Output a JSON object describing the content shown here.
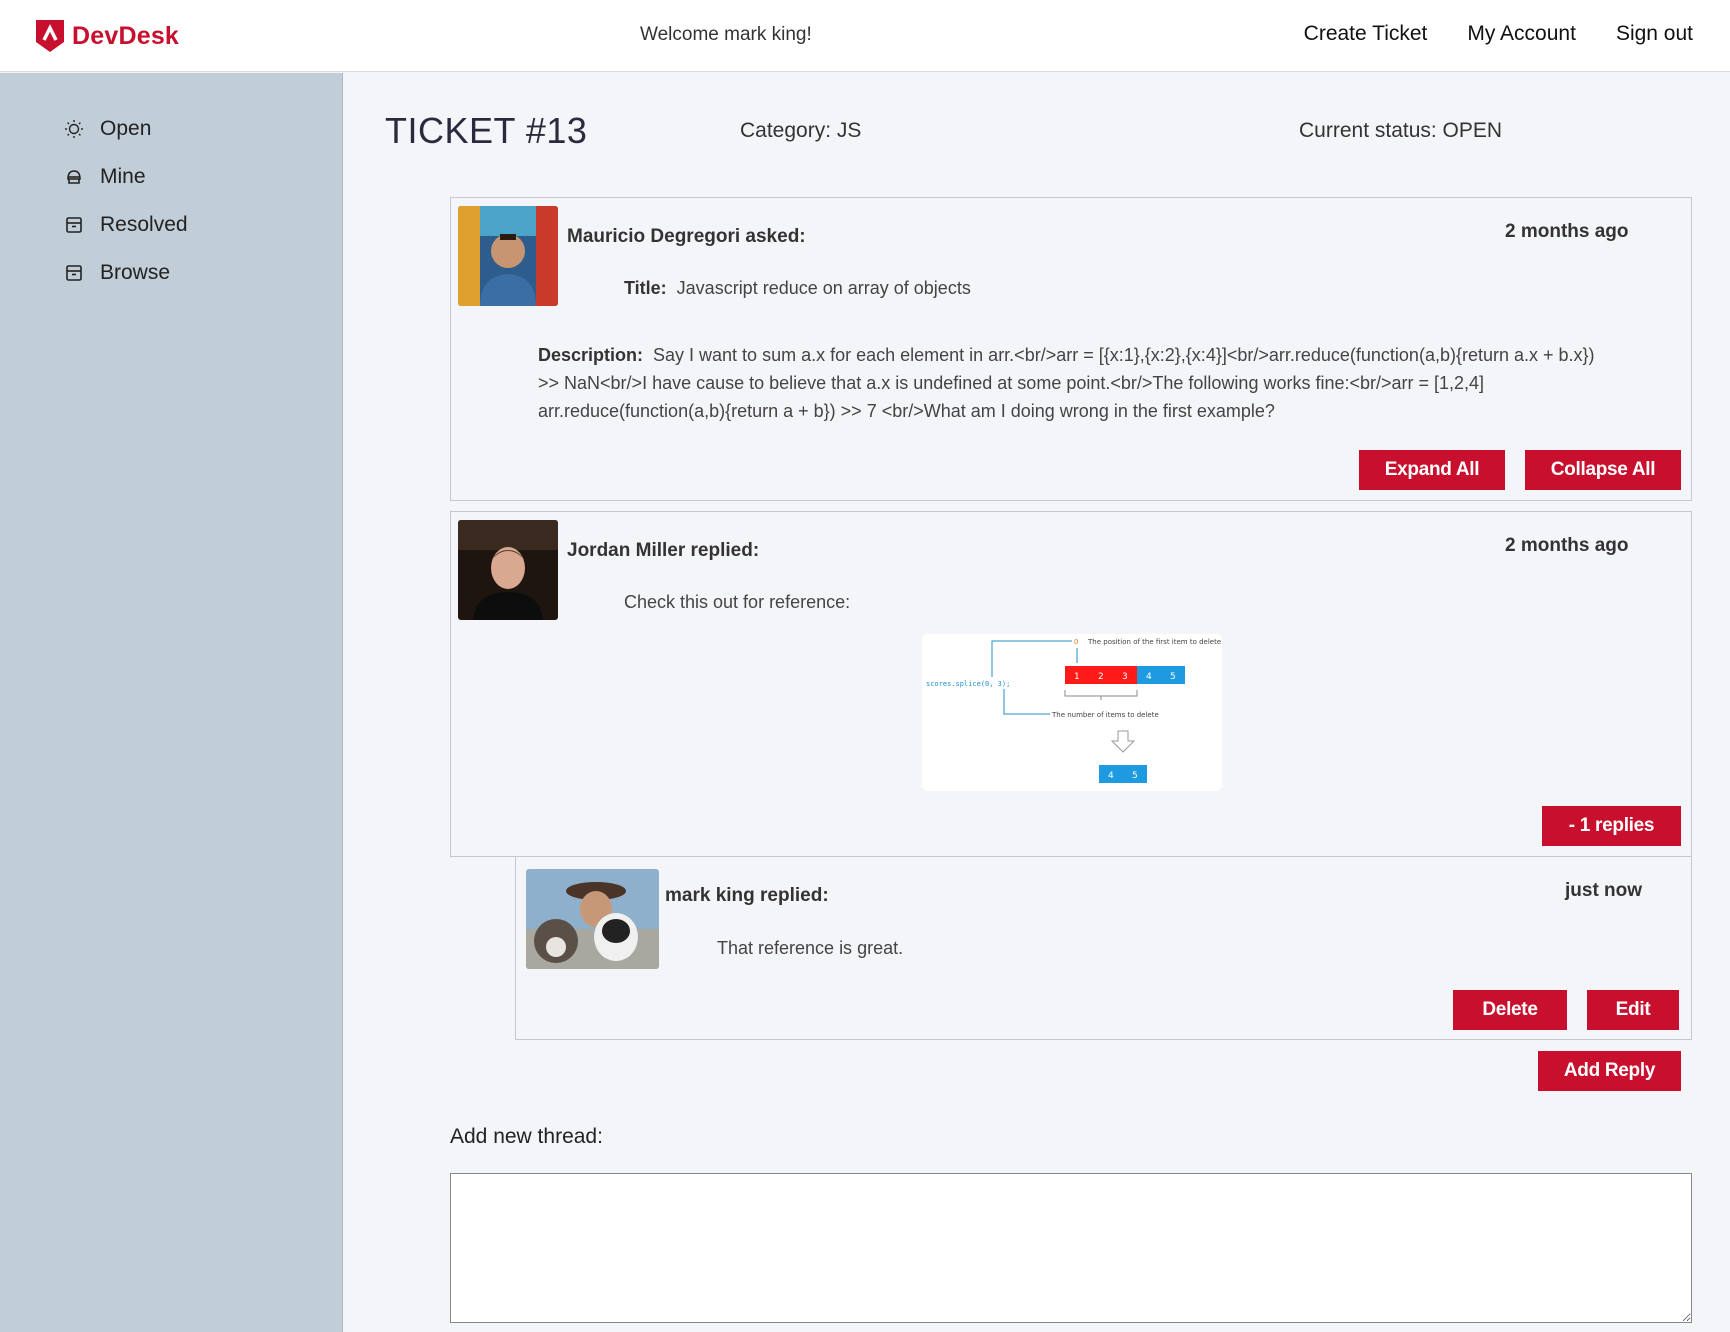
{
  "app": {
    "name": "DevDesk",
    "welcome": "Welcome mark king!"
  },
  "nav": {
    "create": "Create Ticket",
    "account": "My Account",
    "signout": "Sign out"
  },
  "sidebar": {
    "items": [
      {
        "label": "Open",
        "icon": "lightbulb-icon"
      },
      {
        "label": "Mine",
        "icon": "helmet-icon"
      },
      {
        "label": "Resolved",
        "icon": "archive-icon"
      },
      {
        "label": "Browse",
        "icon": "archive-icon"
      }
    ]
  },
  "ticket": {
    "title": "TICKET #13",
    "category": "Category: JS",
    "status": "Current status: OPEN"
  },
  "question": {
    "author": "Mauricio Degregori asked:",
    "time": "2 months ago",
    "title_label": "Title:",
    "title": "Javascript reduce on array of objects",
    "desc_label": "Description:",
    "description": "Say I want to sum a.x for each element in arr.<br/>arr = [{x:1},{x:2},{x:4}]<br/>arr.reduce(function(a,b){return a.x + b.x}) >> NaN<br/>I have cause to believe that a.x is undefined at some point.<br/>The following works fine:<br/>arr = [1,2,4] arr.reduce(function(a,b){return a + b}) >> 7 <br/>What am I doing wrong in the first example?",
    "expand": "Expand All",
    "collapse": "Collapse All"
  },
  "reply1": {
    "author": "Jordan Miller replied:",
    "time": "2 months ago",
    "text": "Check this out for reference:",
    "replies_btn": "- 1 replies",
    "diagram": {
      "code": "scores.splice(0, 3);",
      "top_label": "The position of the first item to delete",
      "bottom_label": "The number of items to delete",
      "zero": "0",
      "cells": [
        "1",
        "2",
        "3",
        "4",
        "5"
      ],
      "result": [
        "4",
        "5"
      ]
    }
  },
  "reply2": {
    "author": "mark king replied:",
    "time": "just now",
    "text": "That reference is great.",
    "delete": "Delete",
    "edit": "Edit"
  },
  "add_reply": "Add Reply",
  "new_thread": {
    "label": "Add new thread:",
    "value": ""
  },
  "colors": {
    "brand": "#c8102e",
    "sidebar": "#c1ced8",
    "diagram_red": "#ff0000",
    "diagram_blue": "#1e9be0"
  }
}
